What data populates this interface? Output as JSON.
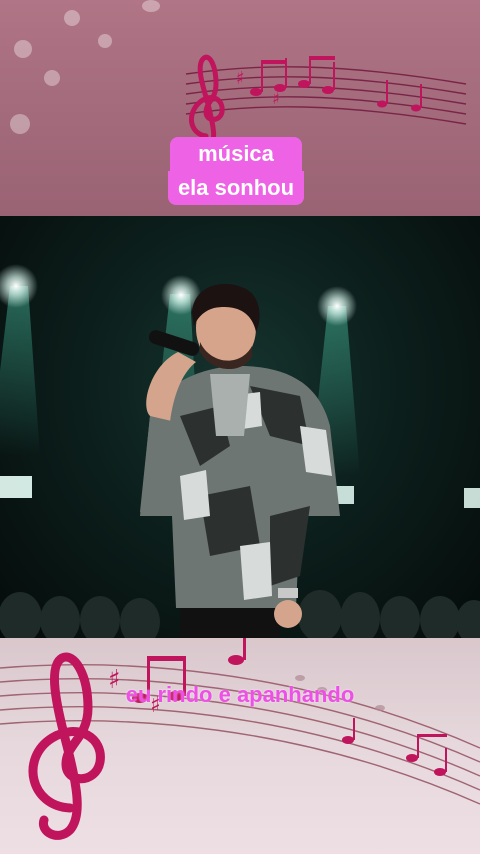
{
  "overlay": {
    "title_line1": "música",
    "title_line2": "ela sonhou",
    "caption": "eu rindo e apanhando"
  },
  "colors": {
    "title_bg": "#ee62e6",
    "caption_text": "#ee4fe6",
    "top_band": "#a26a7b",
    "bottom_band": "#e6d8dc",
    "note_color": "#c0145c"
  },
  "icons": {
    "top_decoration": "treble-clef-music-notes-icon",
    "bottom_decoration": "treble-clef-music-notes-icon"
  }
}
